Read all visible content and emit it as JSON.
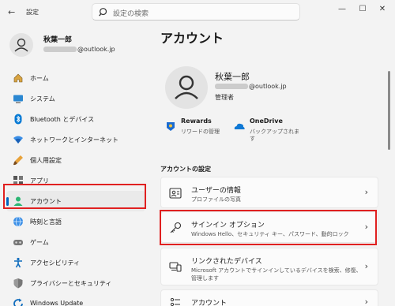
{
  "window": {
    "title": "設定",
    "back_glyph": "←",
    "minimize_glyph": "—",
    "maximize_glyph": "☐",
    "close_glyph": "✕"
  },
  "search": {
    "placeholder": "設定の検索",
    "icon": "search-icon"
  },
  "profile": {
    "name": "秋葉一郎",
    "email_suffix": "@outlook.jp"
  },
  "sidebar": {
    "items": [
      {
        "label": "ホーム",
        "icon": "home-icon"
      },
      {
        "label": "システム",
        "icon": "system-icon"
      },
      {
        "label": "Bluetooth とデバイス",
        "icon": "bluetooth-icon"
      },
      {
        "label": "ネットワークとインターネット",
        "icon": "wifi-icon"
      },
      {
        "label": "個人用設定",
        "icon": "brush-icon"
      },
      {
        "label": "アプリ",
        "icon": "apps-icon"
      },
      {
        "label": "アカウント",
        "icon": "account-icon",
        "active": true
      },
      {
        "label": "時刻と言語",
        "icon": "globe-clock-icon"
      },
      {
        "label": "ゲーム",
        "icon": "game-icon"
      },
      {
        "label": "アクセシビリティ",
        "icon": "accessibility-icon"
      },
      {
        "label": "プライバシーとセキュリティ",
        "icon": "shield-icon"
      },
      {
        "label": "Windows Update",
        "icon": "update-icon"
      }
    ]
  },
  "main": {
    "title": "アカウント",
    "account": {
      "name": "秋葉一郎",
      "email_suffix": "@outlook.jp",
      "role": "管理者"
    },
    "services": [
      {
        "title": "Rewards",
        "sub": "リワードの管理",
        "icon": "rewards-icon"
      },
      {
        "title": "OneDrive",
        "sub": "バックアップされま",
        "sub2": "す",
        "icon": "onedrive-icon"
      }
    ],
    "section_title": "アカウントの設定",
    "cards": [
      {
        "title": "ユーザーの情報",
        "sub": "プロファイルの写真",
        "icon": "user-info-icon"
      },
      {
        "title": "サインイン オプション",
        "sub": "Windows Hello、セキュリティ キー、パスワード、動的ロック",
        "icon": "key-icon"
      },
      {
        "title": "リンクされたデバイス",
        "sub": "Microsoft アカウントでサインインしているデバイスを検索、修復、",
        "sub2": "管理します",
        "icon": "linked-devices-icon"
      },
      {
        "title": "アカウント",
        "sub": "",
        "icon": "list-icon"
      }
    ],
    "chevron": "›"
  },
  "colors": {
    "accent": "#0067c0",
    "highlight": "#e02020"
  }
}
